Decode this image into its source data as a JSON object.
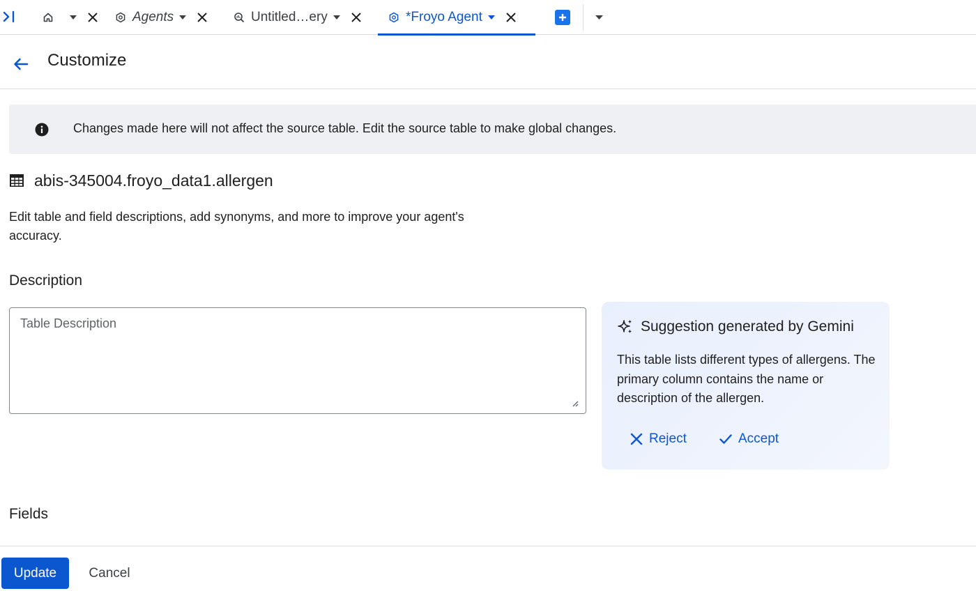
{
  "tabs": [
    {
      "label": "",
      "icon": "home-icon",
      "has_caret": true,
      "active": false
    },
    {
      "label": "Agents",
      "icon": "agent-icon",
      "has_caret": true,
      "active": false,
      "italic": true
    },
    {
      "label": "Untitled…ery",
      "icon": "query-icon",
      "has_caret": true,
      "active": false
    },
    {
      "label": "*Froyo Agent",
      "icon": "agent-icon",
      "has_caret": true,
      "active": true
    }
  ],
  "header": {
    "title": "Customize"
  },
  "banner": {
    "text": "Changes made here will not affect the source table. Edit the source table to make global changes."
  },
  "table": {
    "name": "abis-345004.froyo_data1.allergen"
  },
  "intro": "Edit table and field descriptions, add synonyms, and more to improve your agent's accuracy.",
  "description": {
    "label": "Description",
    "placeholder": "Table Description",
    "value": ""
  },
  "suggestion": {
    "title": "Suggestion generated by Gemini",
    "body": "This table lists different types of allergens. The primary column contains the name or description of the allergen.",
    "reject_label": "Reject",
    "accept_label": "Accept"
  },
  "fields": {
    "label": "Fields"
  },
  "footer": {
    "update_label": "Update",
    "cancel_label": "Cancel"
  },
  "colors": {
    "accent": "#0b57d0",
    "banner_bg": "#eef0f4",
    "border": "#dadce0"
  }
}
